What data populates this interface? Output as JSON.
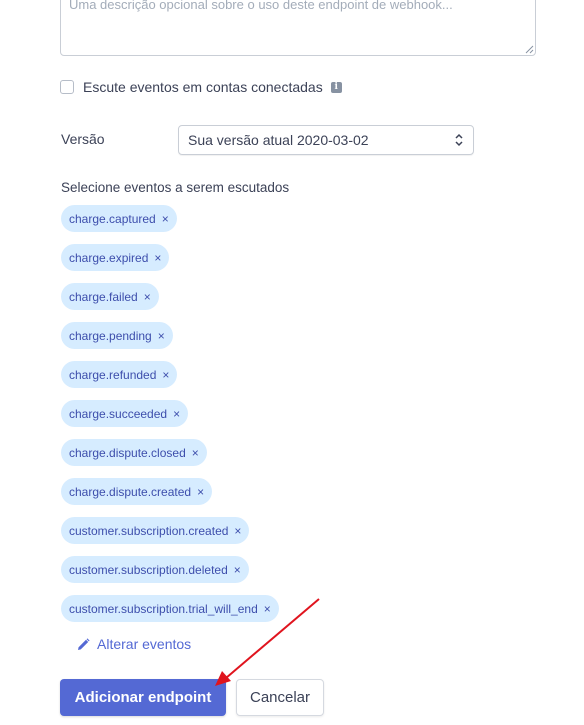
{
  "description": {
    "placeholder": "Uma descrição opcional sobre o uso deste endpoint de webhook..."
  },
  "connected_accounts": {
    "label": "Escute eventos em contas conectadas",
    "checked": false,
    "info_icon": "info-icon"
  },
  "version": {
    "label": "Versão",
    "selected": "Sua versão atual 2020-03-02"
  },
  "events": {
    "label": "Selecione eventos a serem escutados",
    "items": [
      "charge.captured",
      "charge.expired",
      "charge.failed",
      "charge.pending",
      "charge.refunded",
      "charge.succeeded",
      "charge.dispute.closed",
      "charge.dispute.created",
      "customer.subscription.created",
      "customer.subscription.deleted",
      "customer.subscription.trial_will_end"
    ],
    "remove_glyph": "×",
    "alter_label": "Alterar eventos"
  },
  "actions": {
    "submit_label": "Adicionar endpoint",
    "cancel_label": "Cancelar"
  },
  "colors": {
    "accent": "#5469d4",
    "chip_bg": "#d6ecff",
    "chip_text": "#3d4eac",
    "annotation_arrow": "#e0141e"
  }
}
